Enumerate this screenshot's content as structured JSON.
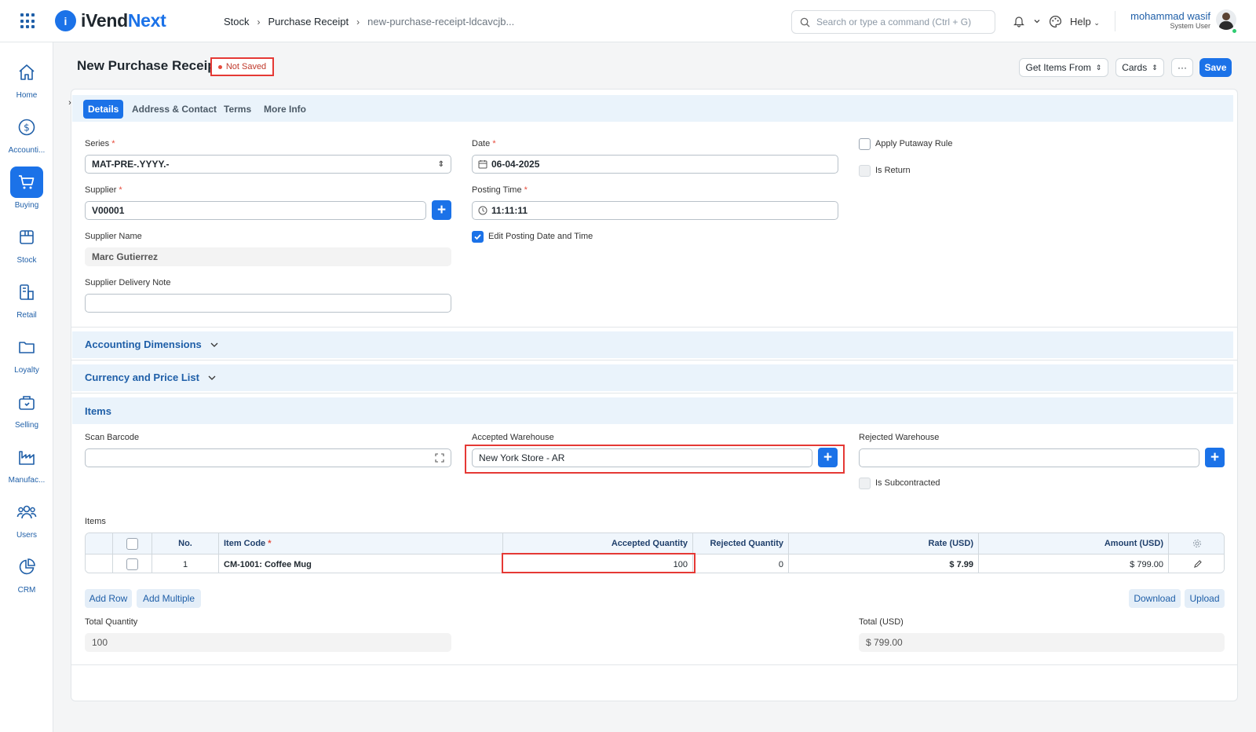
{
  "app": {
    "logo_mark": "i",
    "logo_name_1": "iVend",
    "logo_name_2": "Next"
  },
  "breadcrumb": [
    "Stock",
    "Purchase Receipt",
    "new-purchase-receipt-ldcavcjb..."
  ],
  "search": {
    "placeholder": "Search or type a command (Ctrl + G)"
  },
  "nav": {
    "help": "Help"
  },
  "user": {
    "name": "mohammad wasif",
    "role": "System User"
  },
  "sidebar": {
    "items": [
      {
        "label": "Home",
        "icon": "home-icon"
      },
      {
        "label": "Accounti...",
        "icon": "dollar-icon"
      },
      {
        "label": "Buying",
        "icon": "cart-icon",
        "active": true
      },
      {
        "label": "Stock",
        "icon": "box-icon"
      },
      {
        "label": "Retail",
        "icon": "store-icon"
      },
      {
        "label": "Loyalty",
        "icon": "folder-icon"
      },
      {
        "label": "Selling",
        "icon": "bag-icon"
      },
      {
        "label": "Manufac...",
        "icon": "factory-icon"
      },
      {
        "label": "Users",
        "icon": "users-icon"
      },
      {
        "label": "CRM",
        "icon": "pie-chart-icon"
      }
    ]
  },
  "page": {
    "title": "New Purchase Receipt",
    "status": "Not Saved",
    "actions": {
      "get_items": "Get Items From",
      "cards": "Cards",
      "more": "···",
      "save": "Save"
    }
  },
  "tabs": [
    "Details",
    "Address & Contact",
    "Terms",
    "More Info"
  ],
  "details": {
    "series_label": "Series",
    "series_value": "MAT-PRE-.YYYY.-",
    "supplier_label": "Supplier",
    "supplier_value": "V00001",
    "supplier_name_label": "Supplier Name",
    "supplier_name_value": "Marc Gutierrez",
    "delivery_note_label": "Supplier Delivery Note",
    "delivery_note_value": "",
    "date_label": "Date",
    "date_value": "06-04-2025",
    "posting_time_label": "Posting Time",
    "posting_time_value": "11:11:11",
    "edit_posting_label": "Edit Posting Date and Time",
    "edit_posting_checked": true,
    "putaway_label": "Apply Putaway Rule",
    "is_return_label": "Is Return"
  },
  "sections": {
    "accounting": "Accounting Dimensions",
    "currency": "Currency and Price List",
    "items": "Items"
  },
  "items_section": {
    "scan_barcode_label": "Scan Barcode",
    "scan_barcode_value": "",
    "accepted_wh_label": "Accepted Warehouse",
    "accepted_wh_value": "New York Store - AR",
    "rejected_wh_label": "Rejected Warehouse",
    "rejected_wh_value": "",
    "subcontracted_label": "Is Subcontracted",
    "table_label": "Items",
    "columns": [
      "No.",
      "Item Code",
      "Accepted Quantity",
      "Rejected Quantity",
      "Rate (USD)",
      "Amount (USD)"
    ],
    "rows": [
      {
        "no": "1",
        "item_code": "CM-1001: Coffee Mug",
        "accepted_qty": "100",
        "rejected_qty": "0",
        "rate": "$ 7.99",
        "amount": "$ 799.00"
      }
    ],
    "add_row": "Add Row",
    "add_multiple": "Add Multiple",
    "download": "Download",
    "upload": "Upload"
  },
  "totals": {
    "total_qty_label": "Total Quantity",
    "total_qty_value": "100",
    "total_label": "Total (USD)",
    "total_value": "$ 799.00"
  },
  "colors": {
    "accent": "#1b72e8",
    "highlight": "#e53935",
    "section_bg": "#eaf3fb"
  }
}
